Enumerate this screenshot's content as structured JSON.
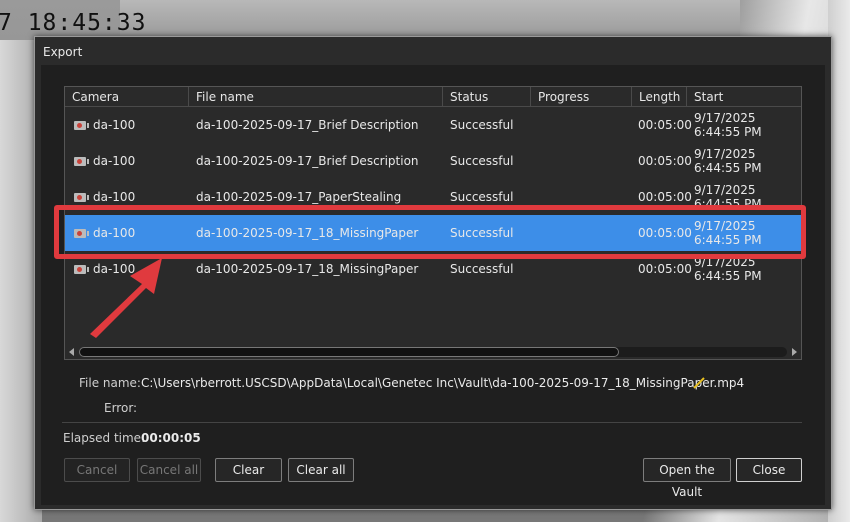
{
  "overlay": {
    "timestamp": "7  18:45:33"
  },
  "dialog": {
    "title": "Export",
    "columns": [
      "Camera",
      "File name",
      "Status",
      "Progress",
      "Length",
      "Start"
    ],
    "rows": [
      {
        "camera": "da-100",
        "file_name": "da-100-2025-09-17_Brief Description",
        "status": "Successful",
        "progress": "",
        "length": "00:05:00",
        "start": "9/17/2025 6:44:55 PM"
      },
      {
        "camera": "da-100",
        "file_name": "da-100-2025-09-17_Brief Description",
        "status": "Successful",
        "progress": "",
        "length": "00:05:00",
        "start": "9/17/2025 6:44:55 PM"
      },
      {
        "camera": "da-100",
        "file_name": "da-100-2025-09-17_PaperStealing",
        "status": "Successful",
        "progress": "",
        "length": "00:05:00",
        "start": "9/17/2025 6:44:55 PM"
      },
      {
        "camera": "da-100",
        "file_name": "da-100-2025-09-17_18_MissingPaper",
        "status": "Successful",
        "progress": "",
        "length": "00:05:00",
        "start": "9/17/2025 6:44:55 PM",
        "selected": true
      },
      {
        "camera": "da-100",
        "file_name": "da-100-2025-09-17_18_MissingPaper",
        "status": "Successful",
        "progress": "",
        "length": "00:05:00",
        "start": "9/17/2025 6:44:55 PM"
      }
    ],
    "file_name_label": "File name:",
    "file_name_value": "C:\\Users\\rberrott.USCSD\\AppData\\Local\\Genetec Inc\\Vault\\da-100-2025-09-17_18_MissingPaper.mp4",
    "error_label": "Error:",
    "error_value": "",
    "elapsed_label": "Elapsed time:",
    "elapsed_value": "00:00:05",
    "buttons": {
      "cancel": "Cancel",
      "cancel_all": "Cancel all",
      "clear": "Clear",
      "clear_all": "Clear all",
      "open_vault": "Open the Vault",
      "close": "Close"
    }
  },
  "colors": {
    "selected_row": "#3d8ee8",
    "annotation": "#e03a3e",
    "dialog_bg": "#2b2b2b"
  }
}
